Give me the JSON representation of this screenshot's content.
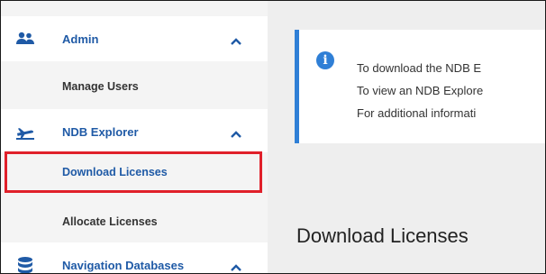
{
  "sidebar": {
    "items": [
      {
        "label": "Admin",
        "icon": "users-icon",
        "expanded": true
      },
      {
        "label": "Manage Users"
      },
      {
        "label": "NDB Explorer",
        "icon": "airplane-icon",
        "expanded": true
      },
      {
        "label": "Download Licenses",
        "selected": true
      },
      {
        "label": "Allocate Licenses"
      },
      {
        "label": "Navigation Databases",
        "icon": "database-icon",
        "expanded": true
      }
    ]
  },
  "alert": {
    "icon": "info-icon",
    "lines": [
      "To download the NDB E",
      "To view an NDB Explore",
      "For additional informati"
    ]
  },
  "main": {
    "heading": "Download Licenses"
  },
  "colors": {
    "accent": "#1f5aa6",
    "alert_border": "#2f7fd6",
    "highlight": "#e0202a"
  }
}
